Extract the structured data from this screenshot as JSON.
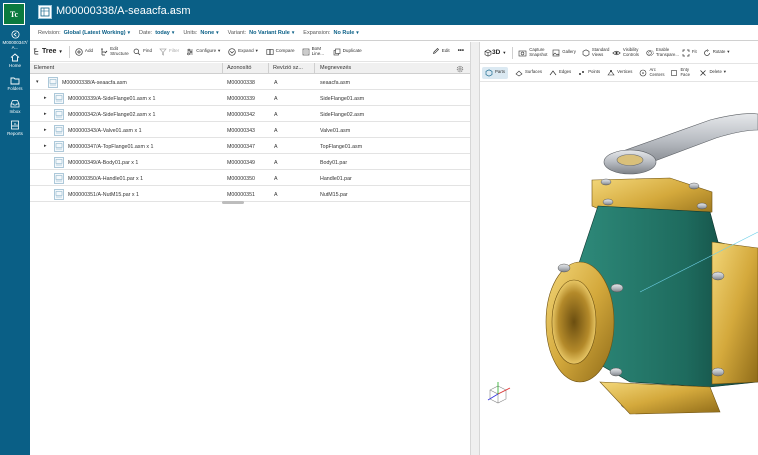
{
  "app": {
    "logo": "Tc"
  },
  "rail": [
    {
      "icon": "back-icon",
      "label": "M00000347/ A..."
    },
    {
      "icon": "home-icon",
      "label": "Home"
    },
    {
      "icon": "folder-icon",
      "label": "Folders"
    },
    {
      "icon": "inbox-icon",
      "label": "Inbox"
    },
    {
      "icon": "reports-icon",
      "label": "Reports"
    }
  ],
  "header": {
    "title": "M00000338/A-seaacfa.asm"
  },
  "revision_bar": {
    "revision_label": "Revision:",
    "revision_value": "Global (Latest Working)",
    "date_label": "Date:",
    "date_value": "today",
    "units_label": "Units:",
    "units_value": "None",
    "variant_label": "Variant:",
    "variant_value": "No Variant Rule",
    "expansion_label": "Expansion:",
    "expansion_value": "No Rule"
  },
  "left_toolbar": {
    "tree": "Tree",
    "add": "Add",
    "edit_structure": "Edit Structure",
    "find": "Find",
    "filter": "Filter",
    "configure": "Configure",
    "expand": "Expand",
    "compare": "Compare",
    "bom_line": "BoM Line...",
    "duplicate": "Duplicate",
    "edit": "Edit",
    "more": "•••"
  },
  "table": {
    "columns": [
      "Element",
      "Azonosító",
      "Revízió  sz...",
      "Megnevezés"
    ],
    "rows": [
      {
        "element": "M00000338/A-seaacfa.asm",
        "id": "M00000338",
        "rev": "A",
        "name": "seaacfa.asm",
        "level": 0,
        "expandable": true,
        "expanded": true
      },
      {
        "element": "M00000339/A-SideFlange01.asm x 1",
        "id": "M00000339",
        "rev": "A",
        "name": "SideFlange01.asm",
        "level": 1,
        "expandable": true,
        "expanded": false
      },
      {
        "element": "M00000342/A-SideFlange02.asm x 1",
        "id": "M00000342",
        "rev": "A",
        "name": "SideFlange02.asm",
        "level": 1,
        "expandable": true,
        "expanded": false
      },
      {
        "element": "M00000343/A-Valve01.asm x 1",
        "id": "M00000343",
        "rev": "A",
        "name": "Valve01.asm",
        "level": 1,
        "expandable": true,
        "expanded": false
      },
      {
        "element": "M00000347/A-TopFlange01.asm x 1",
        "id": "M00000347",
        "rev": "A",
        "name": "TopFlange01.asm",
        "level": 1,
        "expandable": true,
        "expanded": false
      },
      {
        "element": "M00000349/A-Body01.par x 1",
        "id": "M00000349",
        "rev": "A",
        "name": "Body01.par",
        "level": 1,
        "expandable": false,
        "expanded": false
      },
      {
        "element": "M00000350/A-Handle01.par x 1",
        "id": "M00000350",
        "rev": "A",
        "name": "Handle01.par",
        "level": 1,
        "expandable": false,
        "expanded": false
      },
      {
        "element": "M00000351/A-NutM15.par x 1",
        "id": "M00000351",
        "rev": "A",
        "name": "NutM15.par",
        "level": 1,
        "expandable": false,
        "expanded": false
      }
    ]
  },
  "right_toolbar": {
    "mode": "3D",
    "capture": "Capture Snapshot",
    "gallery": "Gallery",
    "standard_views": "Standard Views",
    "visibility": "Visibility Controls",
    "enable_transparency": "Enable Transpare...",
    "fit": "Fit",
    "rotate": "Rotate"
  },
  "right_toolbar2": {
    "parts": "Parts",
    "surfaces": "Surfaces",
    "edges": "Edges",
    "points": "Points",
    "vertices": "Vertices",
    "arc_centers": "Arc Centers",
    "entity_face": "Enty Face",
    "delete": "Delete"
  },
  "colors": {
    "brand": "#0a5f86",
    "gold": "#d4a93c",
    "teal": "#1e6b5e",
    "steel": "#b8bcc2"
  }
}
